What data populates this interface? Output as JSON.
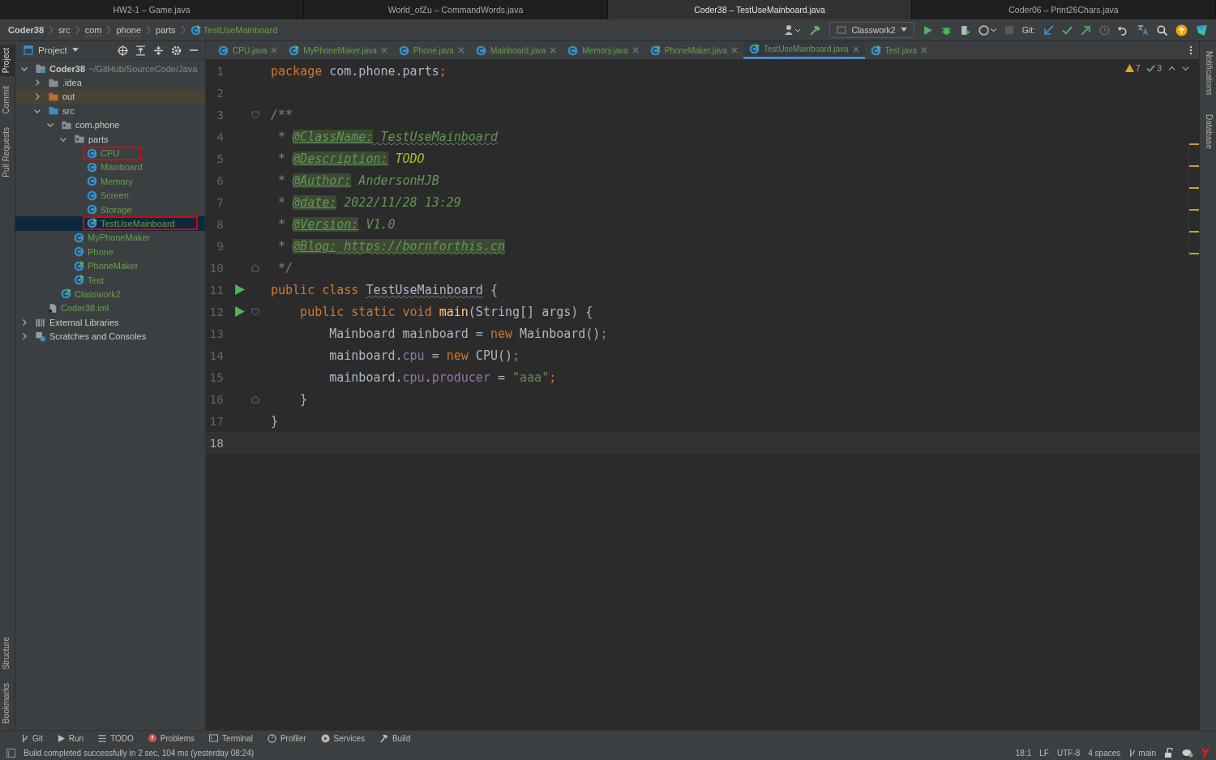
{
  "window_tabs": [
    {
      "title": "HW2-1 – Game.java",
      "selected": false
    },
    {
      "title": "World_ofZu – CommandWords.java",
      "selected": false
    },
    {
      "title": "Coder38 – TestUseMainboard.java",
      "selected": true
    },
    {
      "title": "Coder06 – Print26Chars.java",
      "selected": false
    }
  ],
  "breadcrumbs": [
    {
      "label": "Coder38",
      "kind": "project"
    },
    {
      "label": "src",
      "kind": "dir"
    },
    {
      "label": "com",
      "kind": "dir"
    },
    {
      "label": "phone",
      "kind": "dir"
    },
    {
      "label": "parts",
      "kind": "dir"
    },
    {
      "label": "TestUseMainboard",
      "kind": "class"
    }
  ],
  "toolbar": {
    "run_config": "Classwork2",
    "git_label": "Git:"
  },
  "left_stripe": {
    "top": [
      {
        "label": "Project",
        "selected": true
      },
      {
        "label": "Commit",
        "selected": false
      },
      {
        "label": "Pull Requests",
        "selected": false
      }
    ],
    "bottom": [
      {
        "label": "Structure",
        "selected": false
      },
      {
        "label": "Bookmarks",
        "selected": false
      }
    ]
  },
  "right_stripe": [
    {
      "label": "Notifications"
    },
    {
      "label": "Database"
    }
  ],
  "project_panel": {
    "title": "Project",
    "tree": [
      {
        "label": "Coder38",
        "path": "~/GitHub/SourceCode/Java",
        "kind": "module",
        "expanded": true,
        "selected": false,
        "marked": false,
        "children": [
          {
            "label": ".idea",
            "kind": "folder",
            "expanded": false,
            "selected": false,
            "marked": false
          },
          {
            "label": "out",
            "kind": "excluded",
            "expanded": false,
            "selected": false,
            "marked": false
          },
          {
            "label": "src",
            "kind": "source",
            "expanded": true,
            "selected": false,
            "marked": false,
            "children": [
              {
                "label": "com.phone",
                "kind": "package",
                "expanded": true,
                "selected": false,
                "marked": false,
                "children": [
                  {
                    "label": "parts",
                    "kind": "package",
                    "expanded": true,
                    "selected": false,
                    "marked": false,
                    "children": [
                      {
                        "label": "CPU",
                        "kind": "class",
                        "selected": false,
                        "marked": true
                      },
                      {
                        "label": "Mainboard",
                        "kind": "class",
                        "selected": false,
                        "marked": false
                      },
                      {
                        "label": "Memory",
                        "kind": "class",
                        "selected": false,
                        "marked": false
                      },
                      {
                        "label": "Screen",
                        "kind": "class",
                        "selected": false,
                        "marked": false
                      },
                      {
                        "label": "Storage",
                        "kind": "class",
                        "selected": false,
                        "marked": false
                      },
                      {
                        "label": "TestUseMainboard",
                        "kind": "main",
                        "selected": true,
                        "marked": true
                      }
                    ]
                  },
                  {
                    "label": "MyPhoneMaker",
                    "kind": "class",
                    "selected": false,
                    "marked": false
                  },
                  {
                    "label": "Phone",
                    "kind": "class",
                    "selected": false,
                    "marked": false
                  },
                  {
                    "label": "PhoneMaker",
                    "kind": "main",
                    "selected": false,
                    "marked": false
                  },
                  {
                    "label": "Test",
                    "kind": "main",
                    "selected": false,
                    "marked": false
                  }
                ]
              },
              {
                "label": "Classwork2",
                "kind": "main",
                "selected": false,
                "marked": false
              }
            ]
          },
          {
            "label": "Coder38.iml",
            "kind": "iml",
            "selected": false,
            "marked": false
          }
        ]
      },
      {
        "label": "External Libraries",
        "kind": "libraries",
        "expanded": false,
        "selected": false,
        "marked": false
      },
      {
        "label": "Scratches and Consoles",
        "kind": "scratches",
        "expanded": false,
        "selected": false,
        "marked": false
      }
    ]
  },
  "editor_tabs": [
    {
      "label": "CPU.java",
      "kind": "class",
      "selected": false
    },
    {
      "label": "MyPhoneMaker.java",
      "kind": "main",
      "selected": false
    },
    {
      "label": "Phone.java",
      "kind": "class",
      "selected": false
    },
    {
      "label": "Mainboard.java",
      "kind": "class",
      "selected": false
    },
    {
      "label": "Memory.java",
      "kind": "class",
      "selected": false
    },
    {
      "label": "PhoneMaker.java",
      "kind": "main",
      "selected": false
    },
    {
      "label": "TestUseMainboard.java",
      "kind": "main",
      "selected": true
    },
    {
      "label": "Test.java",
      "kind": "main",
      "selected": false
    }
  ],
  "inspections": {
    "warnings": "7",
    "weak_warnings": "3"
  },
  "code_lines": [
    {
      "number": "1",
      "current": false,
      "tokens": [
        {
          "text": "package",
          "kind": "kw"
        },
        {
          "text": " com.phone.parts",
          "kind": "plain"
        },
        {
          "text": ";",
          "kind": "kw"
        }
      ]
    },
    {
      "number": "2",
      "current": false
    },
    {
      "number": "3",
      "current": false,
      "fold_start": true,
      "tokens": [
        {
          "text": "/**",
          "kind": "doc"
        }
      ]
    },
    {
      "number": "4",
      "current": false,
      "tokens": [
        {
          "text": " * ",
          "kind": "doc"
        },
        {
          "text": "@ClassName:",
          "kind": "tag"
        },
        {
          "text": " TestUseMainboard",
          "kind": "doc-typo"
        }
      ]
    },
    {
      "number": "5",
      "current": false,
      "tokens": [
        {
          "text": " * ",
          "kind": "doc"
        },
        {
          "text": "@Description:",
          "kind": "tag"
        },
        {
          "text": " TODO",
          "kind": "todo"
        }
      ]
    },
    {
      "number": "6",
      "current": false,
      "tokens": [
        {
          "text": " * ",
          "kind": "doc"
        },
        {
          "text": "@Author:",
          "kind": "tag"
        },
        {
          "text": " AndersonHJB",
          "kind": "doc"
        }
      ]
    },
    {
      "number": "7",
      "current": false,
      "tokens": [
        {
          "text": " * ",
          "kind": "doc"
        },
        {
          "text": "@date:",
          "kind": "tag"
        },
        {
          "text": " 2022/11/28 13:29",
          "kind": "doc"
        }
      ]
    },
    {
      "number": "8",
      "current": false,
      "tokens": [
        {
          "text": " * ",
          "kind": "doc"
        },
        {
          "text": "@Version:",
          "kind": "tag"
        },
        {
          "text": " V1.0",
          "kind": "doc"
        }
      ]
    },
    {
      "number": "9",
      "current": false,
      "tokens": [
        {
          "text": " * ",
          "kind": "doc"
        },
        {
          "text": "@Blog:",
          "kind": "tag"
        },
        {
          "text": " https://bornforthis.cn",
          "kind": "link"
        }
      ]
    },
    {
      "number": "10",
      "current": false,
      "fold_end": true,
      "tokens": [
        {
          "text": " */",
          "kind": "doc"
        }
      ]
    },
    {
      "number": "11",
      "current": false,
      "run_gutter": true,
      "tokens": [
        {
          "text": "public class ",
          "kind": "kw"
        },
        {
          "text": "TestUseMainboard",
          "kind": "typo"
        },
        {
          "text": " {",
          "kind": "plain"
        }
      ]
    },
    {
      "number": "12",
      "current": false,
      "run_gutter": true,
      "fold_start": true,
      "tokens": [
        {
          "text": "    public static void ",
          "kind": "kw"
        },
        {
          "text": "main",
          "kind": "method"
        },
        {
          "text": "(String[] args) {",
          "kind": "plain"
        }
      ]
    },
    {
      "number": "13",
      "current": false,
      "tokens": [
        {
          "text": "        Mainboard mainboard = ",
          "kind": "plain"
        },
        {
          "text": "new",
          "kind": "kw"
        },
        {
          "text": " Mainboard()",
          "kind": "plain"
        },
        {
          "text": ";",
          "kind": "kw"
        }
      ]
    },
    {
      "number": "14",
      "current": false,
      "tokens": [
        {
          "text": "        mainboard.",
          "kind": "plain"
        },
        {
          "text": "cpu",
          "kind": "field"
        },
        {
          "text": " = ",
          "kind": "plain"
        },
        {
          "text": "new",
          "kind": "kw"
        },
        {
          "text": " CPU()",
          "kind": "plain"
        },
        {
          "text": ";",
          "kind": "kw"
        }
      ]
    },
    {
      "number": "15",
      "current": false,
      "tokens": [
        {
          "text": "        mainboard.",
          "kind": "plain"
        },
        {
          "text": "cpu",
          "kind": "field"
        },
        {
          "text": ".",
          "kind": "plain"
        },
        {
          "text": "producer",
          "kind": "field"
        },
        {
          "text": " = ",
          "kind": "plain"
        },
        {
          "text": "\"aaa\"",
          "kind": "string"
        },
        {
          "text": ";",
          "kind": "kw"
        }
      ]
    },
    {
      "number": "16",
      "current": false,
      "fold_end": true,
      "tokens": [
        {
          "text": "    }",
          "kind": "plain"
        }
      ]
    },
    {
      "number": "17",
      "current": false,
      "tokens": [
        {
          "text": "}",
          "kind": "plain"
        }
      ]
    },
    {
      "number": "18",
      "current": true
    }
  ],
  "bottom_tools": [
    {
      "label": "Git",
      "kind": "git"
    },
    {
      "label": "Run",
      "kind": "run"
    },
    {
      "label": "TODO",
      "kind": "todo"
    },
    {
      "label": "Problems",
      "kind": "problems"
    },
    {
      "label": "Terminal",
      "kind": "terminal"
    },
    {
      "label": "Profiler",
      "kind": "profiler"
    },
    {
      "label": "Services",
      "kind": "services"
    },
    {
      "label": "Build",
      "kind": "build"
    }
  ],
  "status_bar": {
    "message": "Build completed successfully in 2 sec, 104 ms (yesterday 08:24)",
    "position": "18:1",
    "line_separator": "LF",
    "encoding": "UTF-8",
    "indent": "4 spaces",
    "branch": "main"
  }
}
